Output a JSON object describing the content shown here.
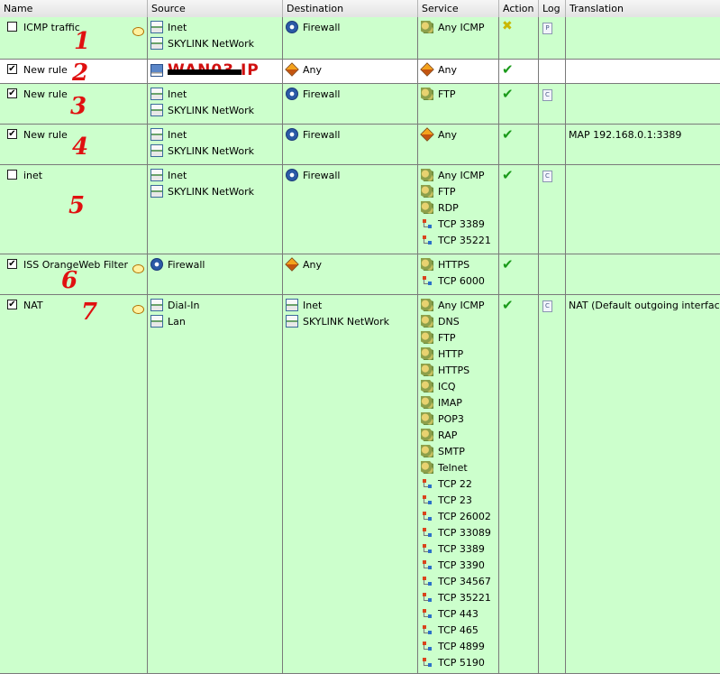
{
  "columns": {
    "name": "Name",
    "source": "Source",
    "destination": "Destination",
    "service": "Service",
    "action": "Action",
    "log": "Log",
    "translation": "Translation"
  },
  "rules": [
    {
      "number": "1",
      "enabled": false,
      "name": "ICMP traffic",
      "has_comment": true,
      "source": [
        "Inet",
        "SKYLINK NetWork"
      ],
      "destination": [
        "Firewall"
      ],
      "service": [
        "Any ICMP"
      ],
      "action": "deny",
      "log": "P",
      "translation": ""
    },
    {
      "number": "2",
      "enabled": true,
      "name": "New rule",
      "has_comment": false,
      "source_redacted": "WAN03 IP",
      "destination": [
        "Any"
      ],
      "service": [
        "Any"
      ],
      "action": "allow",
      "log": "",
      "translation": ""
    },
    {
      "number": "3",
      "enabled": true,
      "name": "New rule",
      "has_comment": false,
      "source": [
        "Inet",
        "SKYLINK NetWork"
      ],
      "destination": [
        "Firewall"
      ],
      "service": [
        "FTP"
      ],
      "action": "allow",
      "log": "C",
      "translation": ""
    },
    {
      "number": "4",
      "enabled": true,
      "name": "New rule",
      "has_comment": false,
      "source": [
        "Inet",
        "SKYLINK NetWork"
      ],
      "destination": [
        "Firewall"
      ],
      "service": [
        "Any"
      ],
      "action": "allow",
      "log": "",
      "translation": "MAP 192.168.0.1:3389"
    },
    {
      "number": "5",
      "enabled": false,
      "name": "inet",
      "has_comment": false,
      "source": [
        "Inet",
        "SKYLINK NetWork"
      ],
      "destination": [
        "Firewall"
      ],
      "service": [
        "Any ICMP",
        "FTP",
        "RDP",
        "TCP 3389",
        "TCP 35221"
      ],
      "action": "allow",
      "log": "C",
      "translation": ""
    },
    {
      "number": "6",
      "enabled": true,
      "name": "ISS OrangeWeb Filter",
      "has_comment": true,
      "source": [
        "Firewall"
      ],
      "destination": [
        "Any"
      ],
      "service": [
        "HTTPS",
        "TCP 6000"
      ],
      "action": "allow",
      "log": "",
      "translation": ""
    },
    {
      "number": "7",
      "enabled": true,
      "name": "NAT",
      "has_comment": true,
      "source": [
        "Dial-In",
        "Lan"
      ],
      "destination": [
        "Inet",
        "SKYLINK NetWork"
      ],
      "service": [
        "Any ICMP",
        "DNS",
        "FTP",
        "HTTP",
        "HTTPS",
        "ICQ",
        "IMAP",
        "POP3",
        "RAP",
        "SMTP",
        "Telnet",
        "TCP 22",
        "TCP 23",
        "TCP 26002",
        "TCP 33089",
        "TCP 3389",
        "TCP 3390",
        "TCP 34567",
        "TCP 35221",
        "TCP 443",
        "TCP 465",
        "TCP 4899",
        "TCP 5190"
      ],
      "action": "allow",
      "log": "C",
      "translation": "NAT (Default outgoing interface)"
    }
  ]
}
